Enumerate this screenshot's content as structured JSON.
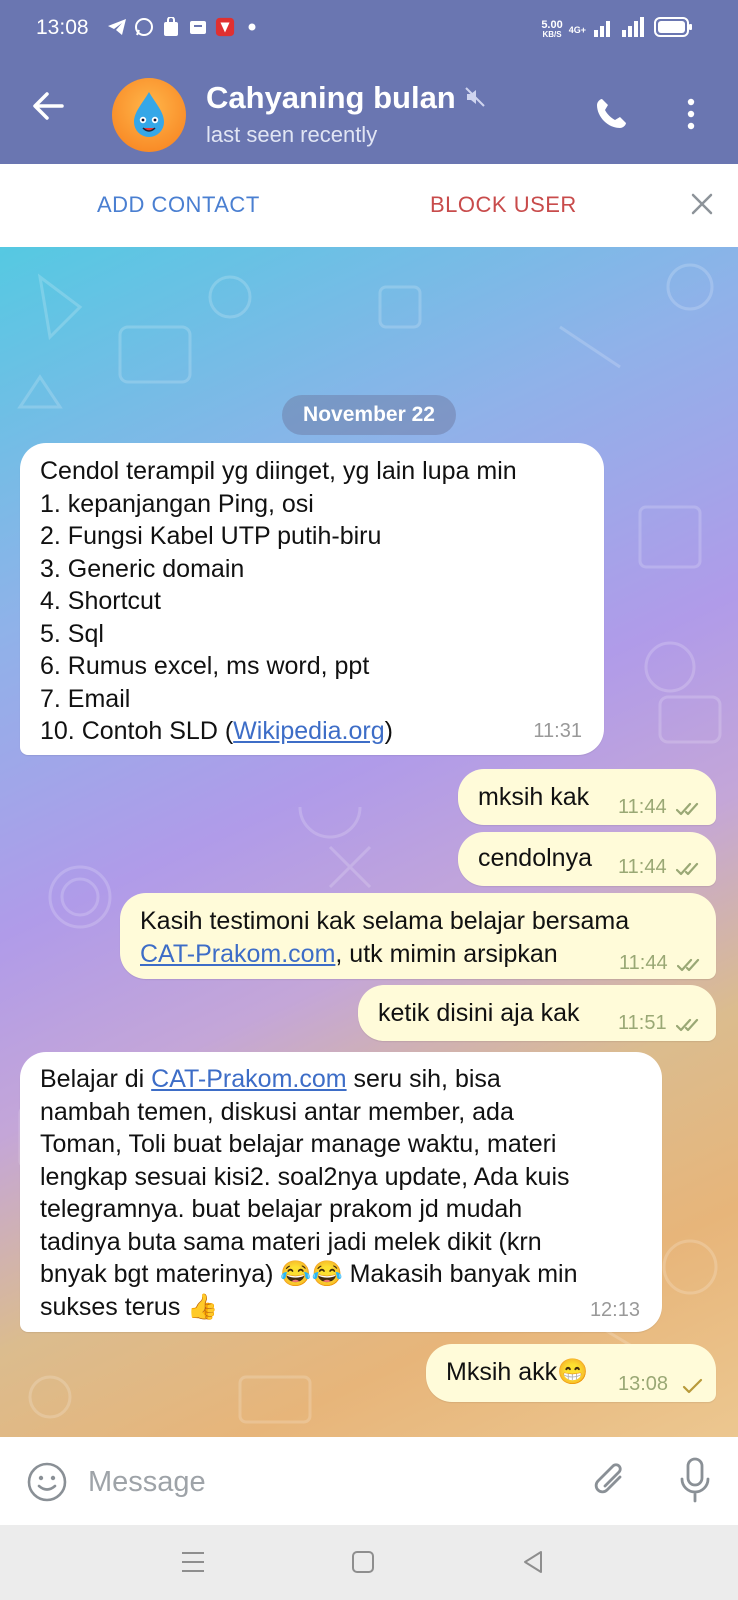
{
  "status_bar": {
    "time": "13:08",
    "speed_value": "5.00",
    "speed_unit": "KB/S",
    "network": "4G+"
  },
  "header": {
    "contact_name": "Cahyaning bulan",
    "status": "last seen recently"
  },
  "actions": {
    "add_contact": "ADD CONTACT",
    "block_user": "BLOCK USER"
  },
  "date_separator": "November 22",
  "messages": [
    {
      "direction": "incoming",
      "lines": [
        "Cendol terampil yg diinget, yg lain lupa min",
        "1. kepanjangan Ping, osi",
        "2. Fungsi Kabel UTP putih-biru",
        "3. Generic domain",
        "4. Shortcut",
        "5. Sql",
        "6. Rumus excel, ms word, ppt",
        "7. Email"
      ],
      "last_prefix": "10. Contoh SLD (",
      "last_link": "Wikipedia.org",
      "last_suffix": ")",
      "time": "11:31"
    },
    {
      "direction": "outgoing",
      "text": "mksih kak",
      "time": "11:44",
      "status": "read"
    },
    {
      "direction": "outgoing",
      "text": "cendolnya",
      "time": "11:44",
      "status": "read"
    },
    {
      "direction": "outgoing",
      "line1": "Kasih testimoni kak selama belajar bersama",
      "link": "CAT-Prakom.com",
      "line2_suffix": ", utk mimin arsipkan",
      "time": "11:44",
      "status": "read"
    },
    {
      "direction": "outgoing",
      "text": "ketik disini aja kak",
      "time": "11:51",
      "status": "read"
    },
    {
      "direction": "incoming",
      "prefix": "Belajar di ",
      "link": "CAT-Prakom.com",
      "line1_suffix": " seru sih, bisa",
      "lines": [
        "nambah temen, diskusi antar member, ada",
        "Toman, Toli buat belajar manage waktu, materi",
        "lengkap sesuai kisi2. soal2nya update, Ada kuis",
        "telegramnya. buat belajar prakom jd mudah",
        "tadinya buta sama materi jadi melek dikit (krn"
      ],
      "line7": "bnyak bgt materinya) 😂😂 Makasih banyak min",
      "line8": "sukses terus 👍",
      "time": "12:13"
    },
    {
      "direction": "outgoing",
      "text": "Mksih akk😁",
      "time": "13:08",
      "status": "sent"
    }
  ],
  "composer": {
    "placeholder": "Message"
  },
  "colors": {
    "header": "#6a76b1",
    "incoming_bubble": "#ffffff",
    "outgoing_bubble": "#fffbd9",
    "link": "#3d6dc7",
    "add_contact": "#4a7fd1",
    "block_user": "#c84b4b"
  }
}
